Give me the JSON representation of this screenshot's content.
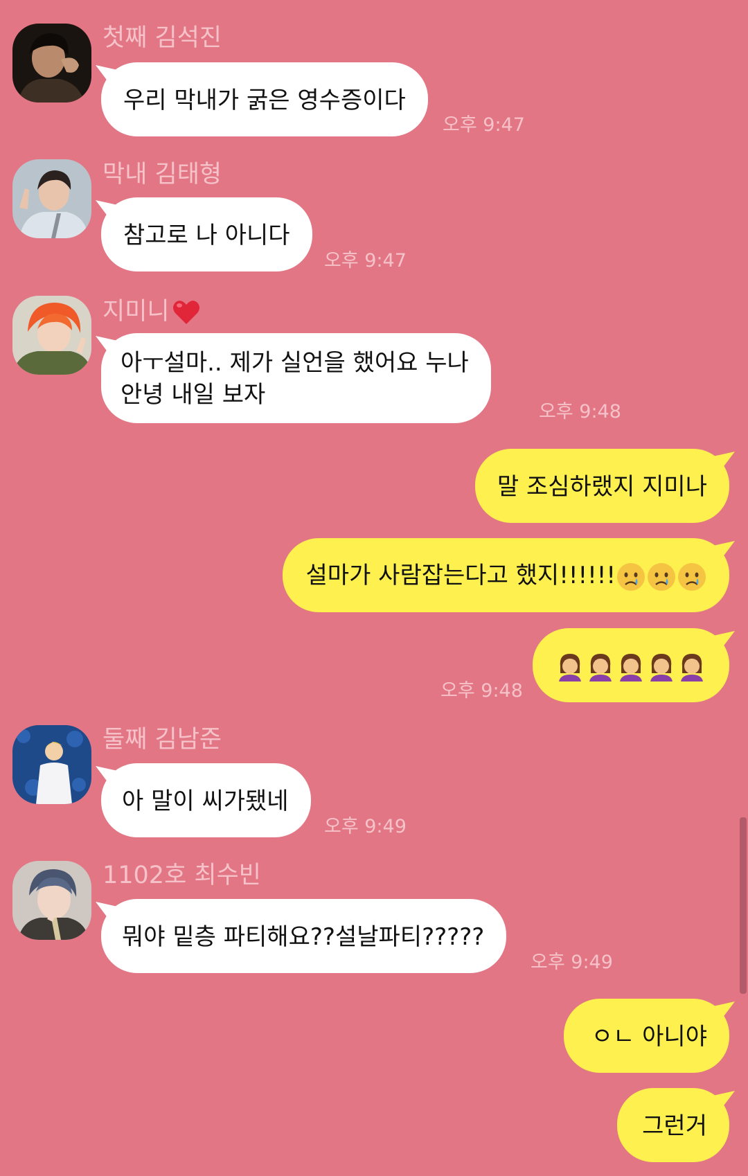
{
  "messages": [
    {
      "sender": "첫째 김석진",
      "lines": [
        "우리 막내가 굵은 영수증이다"
      ],
      "time": "오후 9:47",
      "avatar": "avatar-jin"
    },
    {
      "sender": "막내 김태형",
      "lines": [
        "참고로 나 아니다"
      ],
      "time": "오후 9:47",
      "avatar": "avatar-taehyung"
    },
    {
      "sender": "지미니",
      "lines": [
        "아ㅜ설마.. 제가 실언을 했어요 누나",
        "안녕 내일 보자"
      ],
      "time": "오후 9:48",
      "avatar": "avatar-jimin"
    },
    {
      "lines": [
        "말 조심하랬지 지미나"
      ]
    },
    {
      "lines": [
        "설마가 사람잡는다고 했지!!!!!!"
      ],
      "emoji": [
        "crying-face-emoji",
        "crying-face-emoji",
        "crying-face-emoji"
      ]
    },
    {
      "emoji": [
        "facepalm-emoji",
        "facepalm-emoji",
        "facepalm-emoji",
        "facepalm-emoji",
        "facepalm-emoji"
      ],
      "time": "오후 9:48"
    },
    {
      "sender": "둘째 김남준",
      "lines": [
        "아 말이 씨가됐네"
      ],
      "time": "오후 9:49",
      "avatar": "avatar-namjoon"
    },
    {
      "sender": "1102호 최수빈",
      "lines": [
        "뭐야 밑층 파티해요??설날파티?????"
      ],
      "time": "오후 9:49",
      "avatar": "avatar-soobin"
    },
    {
      "lines": [
        "ㅇㄴ 아니야"
      ]
    },
    {
      "lines": [
        "그런거"
      ]
    }
  ],
  "colors": {
    "background": "#e37684",
    "incoming_bubble": "#ffffff",
    "outgoing_bubble": "#fdf04f",
    "meta_text": "#f6c2c9"
  }
}
